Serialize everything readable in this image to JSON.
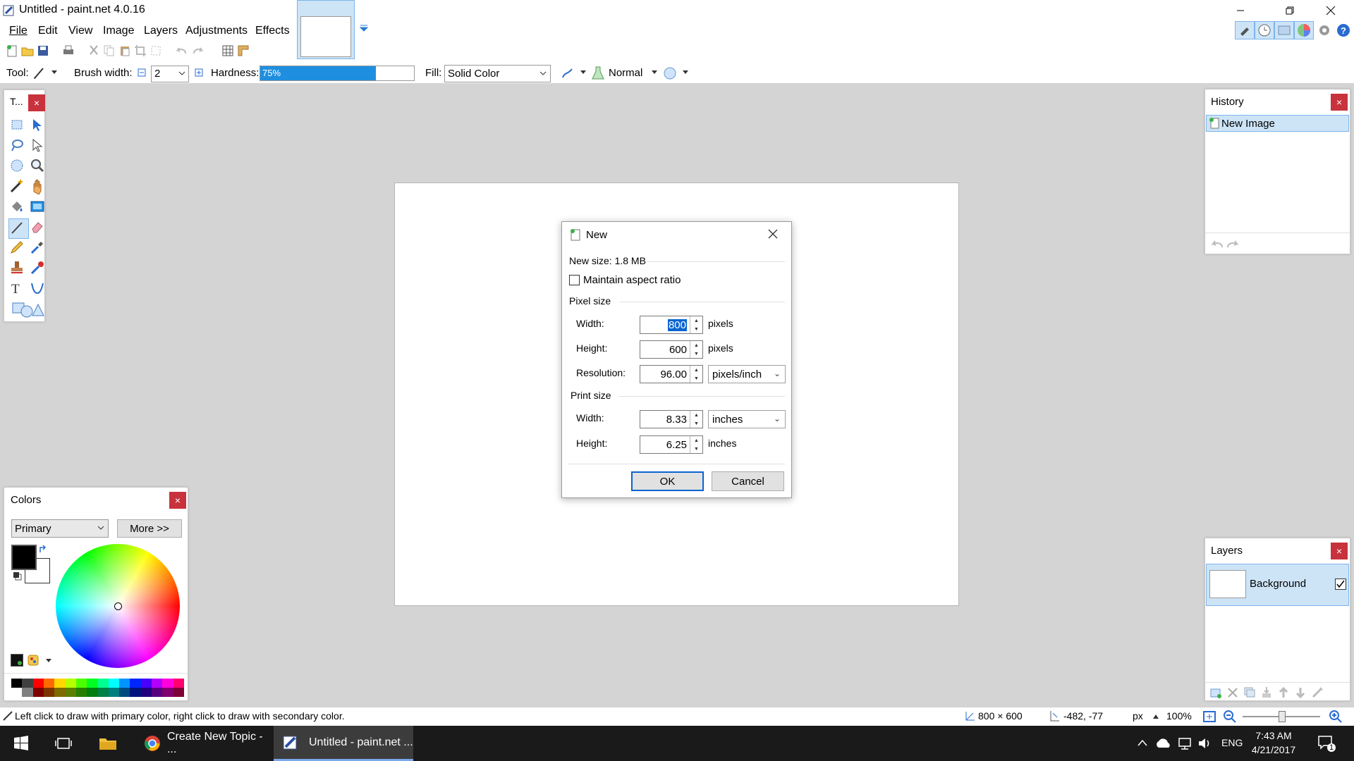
{
  "app": {
    "title": "Untitled - paint.net 4.0.16"
  },
  "menu": [
    "File",
    "Edit",
    "View",
    "Image",
    "Layers",
    "Adjustments",
    "Effects"
  ],
  "toolbar": {
    "tool_label": "Tool:",
    "brush_width_label": "Brush width:",
    "brush_width_value": "2",
    "hardness_label": "Hardness:",
    "hardness_value": "75%",
    "hardness_percent": 75,
    "fill_label": "Fill:",
    "fill_value": "Solid Color",
    "blend_mode": "Normal"
  },
  "tools_panel": {
    "title": "T..."
  },
  "colors_panel": {
    "title": "Colors",
    "selector": "Primary",
    "more_button": "More >>",
    "primary_color": "#000000",
    "secondary_color": "#ffffff",
    "palette": [
      "#000000",
      "#404040",
      "#ff0000",
      "#ff6a00",
      "#ffd800",
      "#b6ff00",
      "#4cff00",
      "#00ff21",
      "#00ff90",
      "#00ffff",
      "#0094ff",
      "#0026ff",
      "#4800ff",
      "#b200ff",
      "#ff00dc",
      "#ff006e"
    ],
    "palette_dark": [
      "#ffffff",
      "#808080",
      "#7f0000",
      "#7f3300",
      "#7f6a00",
      "#5b7f00",
      "#267f00",
      "#007f0e",
      "#007f46",
      "#007f7f",
      "#004a7f",
      "#00137f",
      "#21007f",
      "#57007f",
      "#7f006e",
      "#7f0037"
    ]
  },
  "history_panel": {
    "title": "History",
    "items": [
      "New Image"
    ]
  },
  "layers_panel": {
    "title": "Layers",
    "layers": [
      "Background"
    ]
  },
  "dialog": {
    "title": "New",
    "new_size": "New size: 1.8 MB",
    "maintain_aspect": "Maintain aspect ratio",
    "pixel_size_header": "Pixel size",
    "width_label": "Width:",
    "width_value": "800",
    "height_label": "Height:",
    "height_value": "600",
    "pixels_unit": "pixels",
    "resolution_label": "Resolution:",
    "resolution_value": "96.00",
    "resolution_unit": "pixels/inch",
    "print_size_header": "Print size",
    "print_width_value": "8.33",
    "print_height_value": "6.25",
    "print_unit_select": "inches",
    "print_unit": "inches",
    "ok": "OK",
    "cancel": "Cancel"
  },
  "status": {
    "hint": "Left click to draw with primary color, right click to draw with secondary color.",
    "image_size": "800 × 600",
    "cursor": "-482, -77",
    "unit": "px",
    "zoom": "100%"
  },
  "taskbar": {
    "chrome_label": "Create New Topic - ...",
    "paint_label": "Untitled - paint.net ...",
    "lang": "ENG",
    "time": "7:43 AM",
    "date": "4/21/2017",
    "notif_count": "1"
  }
}
